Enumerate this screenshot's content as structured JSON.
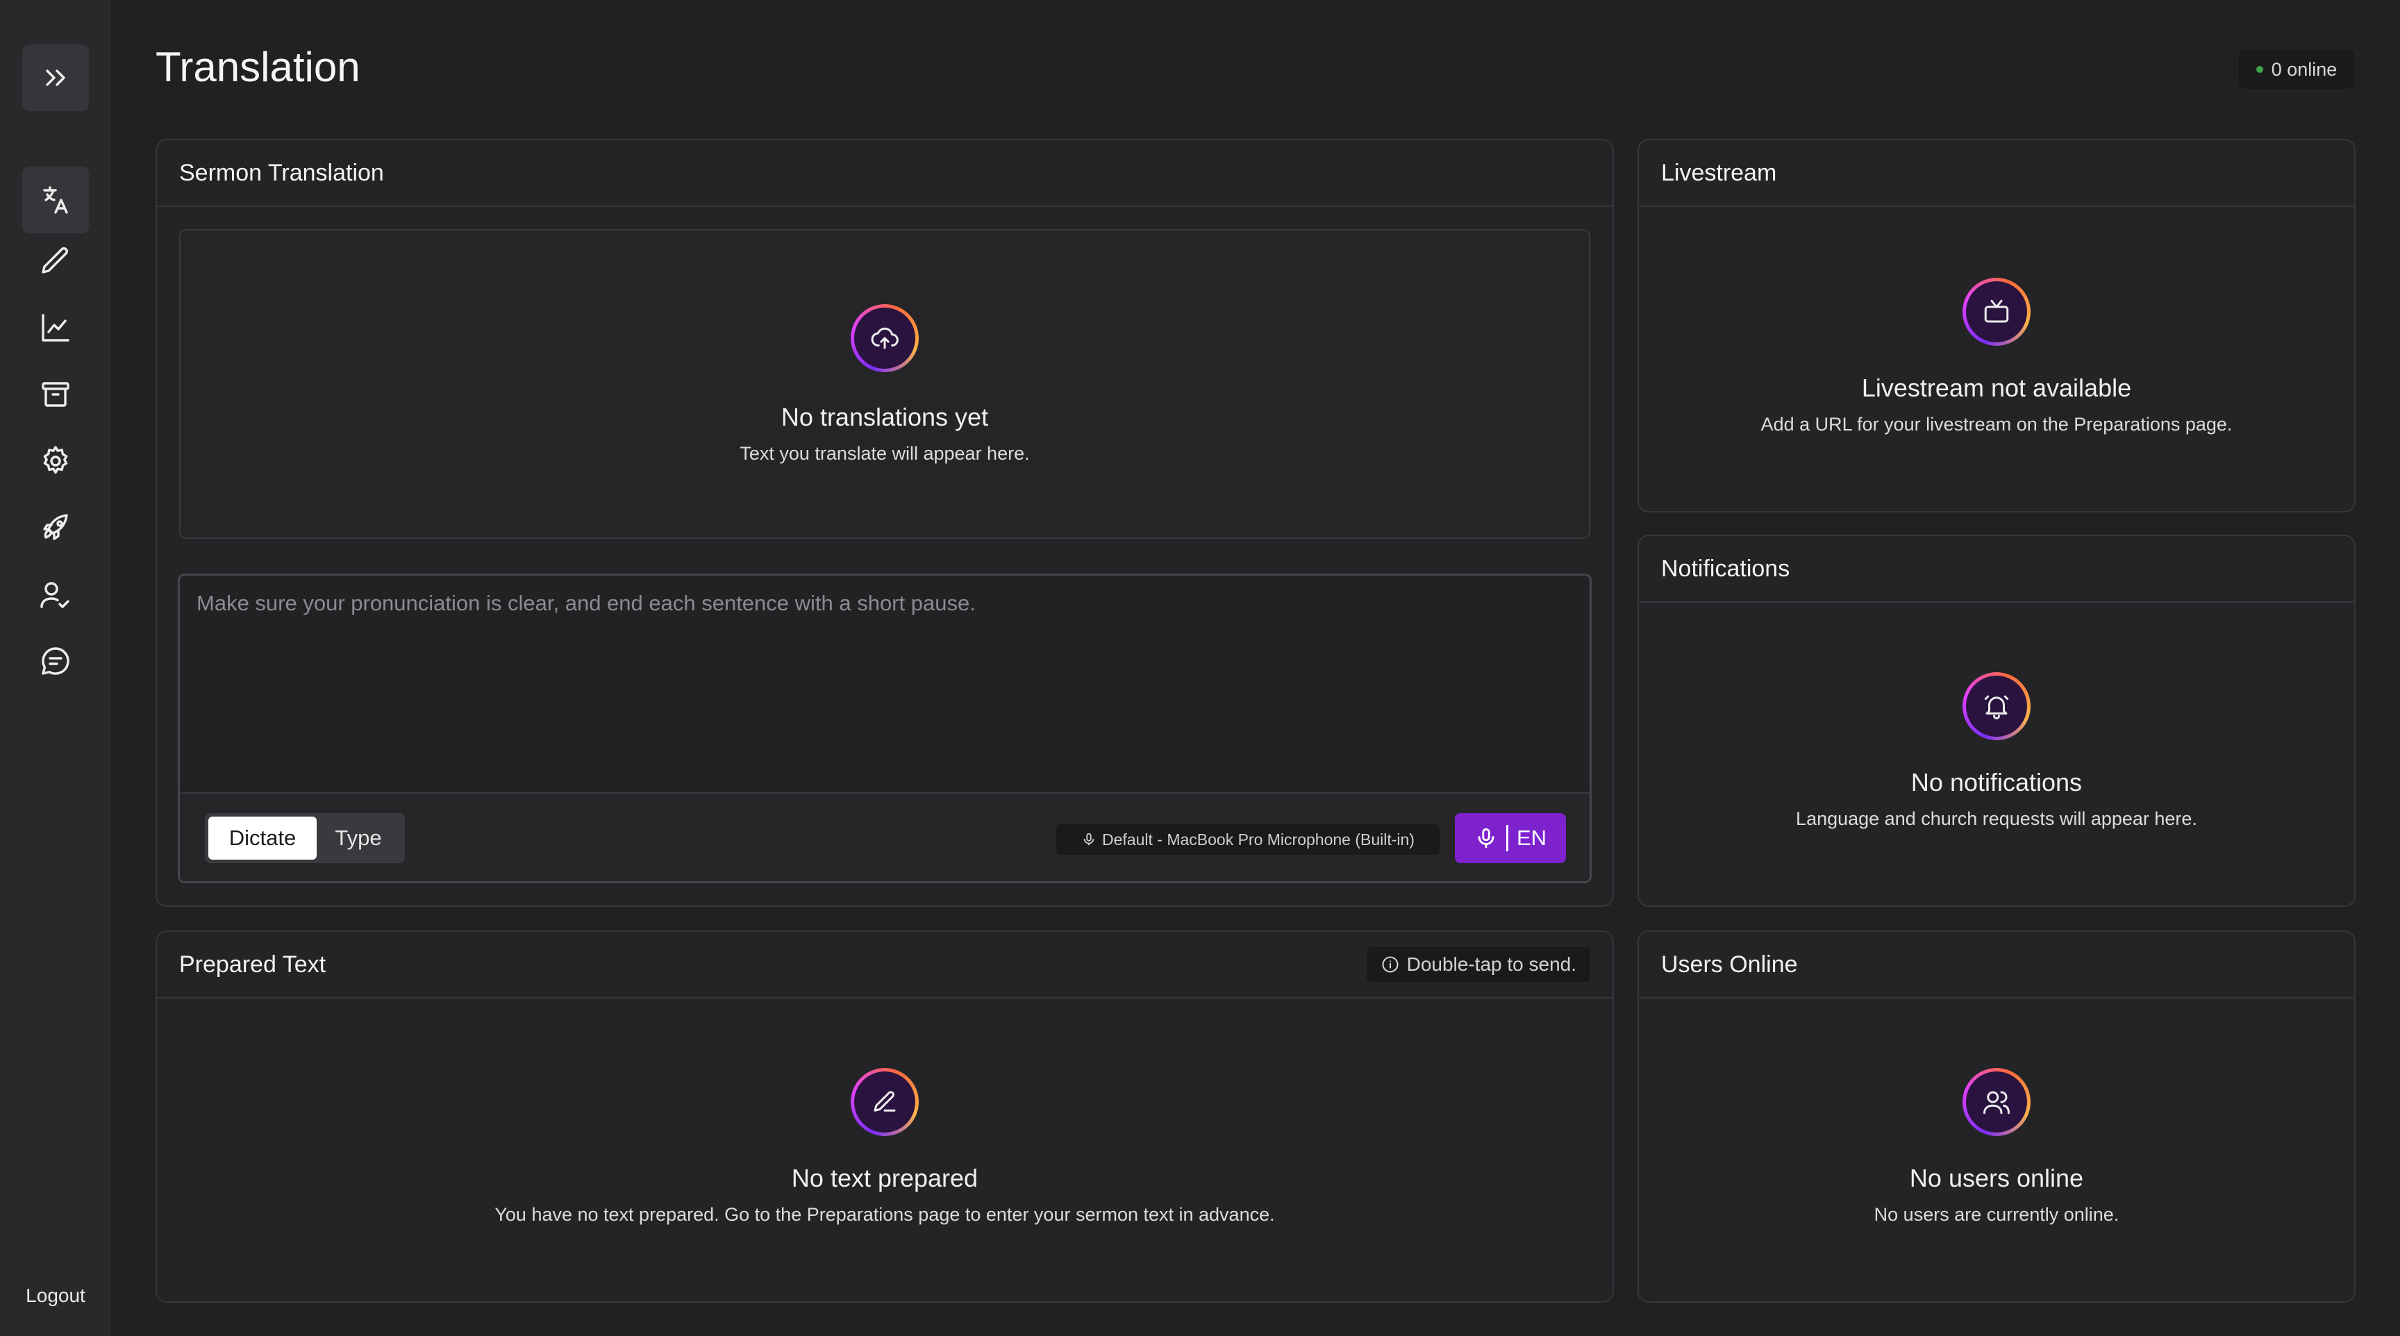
{
  "page": {
    "title": "Translation"
  },
  "status": {
    "online": "0 online"
  },
  "sidebar": {
    "items": [
      {
        "name": "expand",
        "icon": "chevrons-right-icon"
      },
      {
        "name": "translation",
        "icon": "translate-icon"
      },
      {
        "name": "preparations",
        "icon": "pen-icon"
      },
      {
        "name": "analytics",
        "icon": "line-chart-icon"
      },
      {
        "name": "archive",
        "icon": "archive-icon"
      },
      {
        "name": "settings",
        "icon": "gear-icon"
      },
      {
        "name": "launch",
        "icon": "rocket-icon"
      },
      {
        "name": "users",
        "icon": "user-check-icon"
      },
      {
        "name": "messages",
        "icon": "message-icon"
      }
    ],
    "logout": "Logout"
  },
  "sermon": {
    "title": "Sermon Translation",
    "empty_title": "No translations yet",
    "empty_sub": "Text you translate will appear here.",
    "placeholder": "Make sure your pronunciation is clear, and end each sentence with a short pause.",
    "mode_dictate": "Dictate",
    "mode_type": "Type",
    "microphone": "Default - MacBook Pro Microphone (Built-in)",
    "language": "EN"
  },
  "livestream": {
    "title": "Livestream",
    "empty_title": "Livestream not available",
    "empty_sub": "Add a URL for your livestream on the Preparations page."
  },
  "notifications": {
    "title": "Notifications",
    "empty_title": "No notifications",
    "empty_sub": "Language and church requests will appear here."
  },
  "prepared": {
    "title": "Prepared Text",
    "hint": "Double-tap to send.",
    "empty_title": "No text prepared",
    "empty_sub": "You have no text prepared. Go to the Preparations page to enter your sermon text in advance."
  },
  "users_online": {
    "title": "Users Online",
    "empty_title": "No users online",
    "empty_sub": "No users are currently online."
  },
  "colors": {
    "accent": "#7e22ce",
    "background": "#212123",
    "sidebar": "#29292c",
    "online_dot": "#3fa34d"
  }
}
